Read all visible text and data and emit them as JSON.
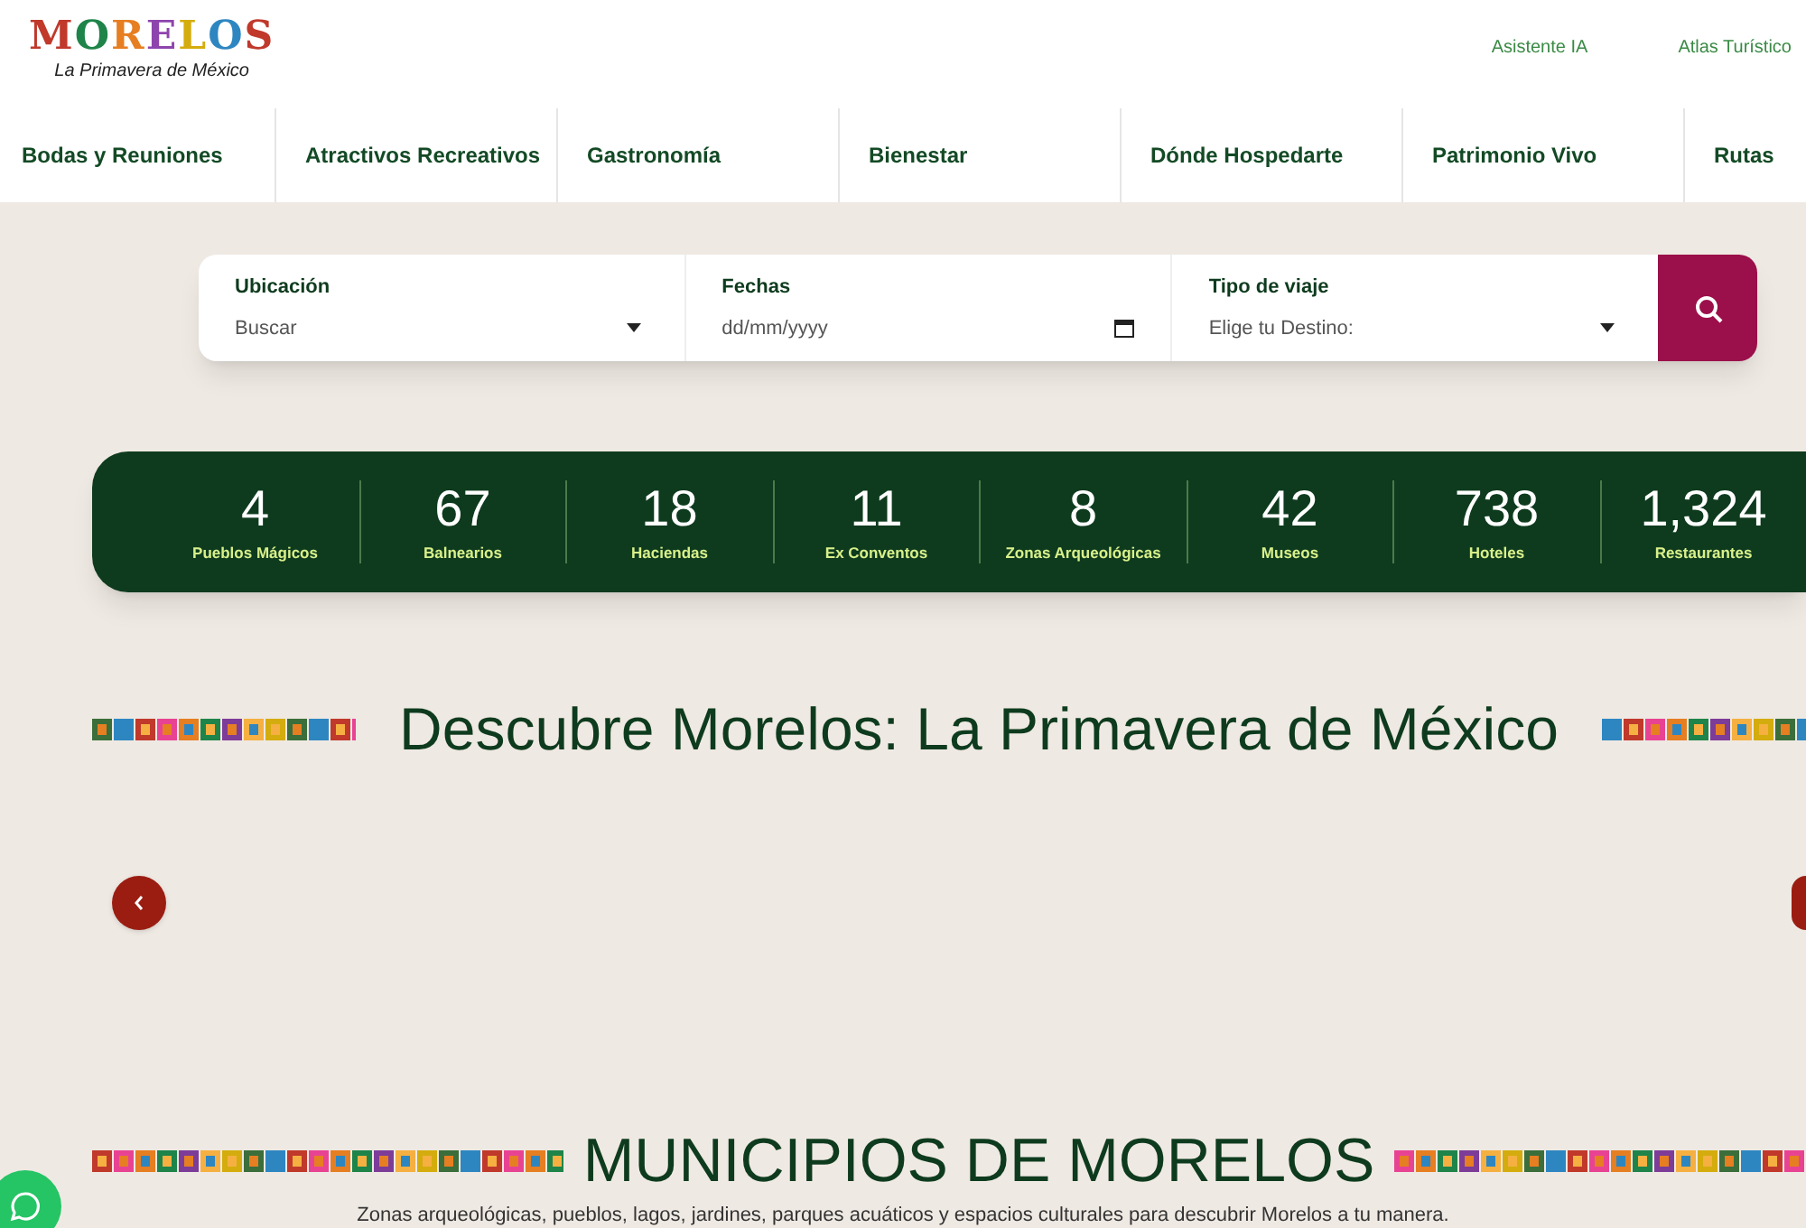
{
  "logo": {
    "wordmark": "MORELOS",
    "tagline": "La Primavera de México"
  },
  "top_links": [
    "Asistente IA",
    "Atlas Turístico"
  ],
  "nav": [
    "Bodas y Reuniones",
    "Atractivos Recreativos",
    "Gastronomía",
    "Bienestar",
    "Dónde Hospedarte",
    "Patrimonio Vivo",
    "Rutas"
  ],
  "search": {
    "fields": [
      {
        "kind": "select",
        "label": "Ubicación",
        "placeholder": "Buscar"
      },
      {
        "kind": "date",
        "label": "Fechas",
        "placeholder": "dd/mm/yyyy"
      },
      {
        "kind": "select",
        "label": "Tipo de viaje",
        "placeholder": "Elige tu Destino:"
      }
    ]
  },
  "stats": [
    {
      "value": "4",
      "label": "Pueblos Mágicos"
    },
    {
      "value": "67",
      "label": "Balnearios"
    },
    {
      "value": "18",
      "label": "Haciendas"
    },
    {
      "value": "11",
      "label": "Ex Conventos"
    },
    {
      "value": "8",
      "label": "Zonas Arqueológicas"
    },
    {
      "value": "42",
      "label": "Museos"
    },
    {
      "value": "738",
      "label": "Hoteles"
    },
    {
      "value": "1,324",
      "label": "Restaurantes"
    }
  ],
  "section_title": "Descubre Morelos: La Primavera de México",
  "municipios": {
    "title": "MUNICIPIOS DE MORELOS",
    "subtitle": "Zonas arqueológicas, pueblos, lagos, jardines, parques acuáticos y espacios culturales para descubrir Morelos a tu manera."
  }
}
